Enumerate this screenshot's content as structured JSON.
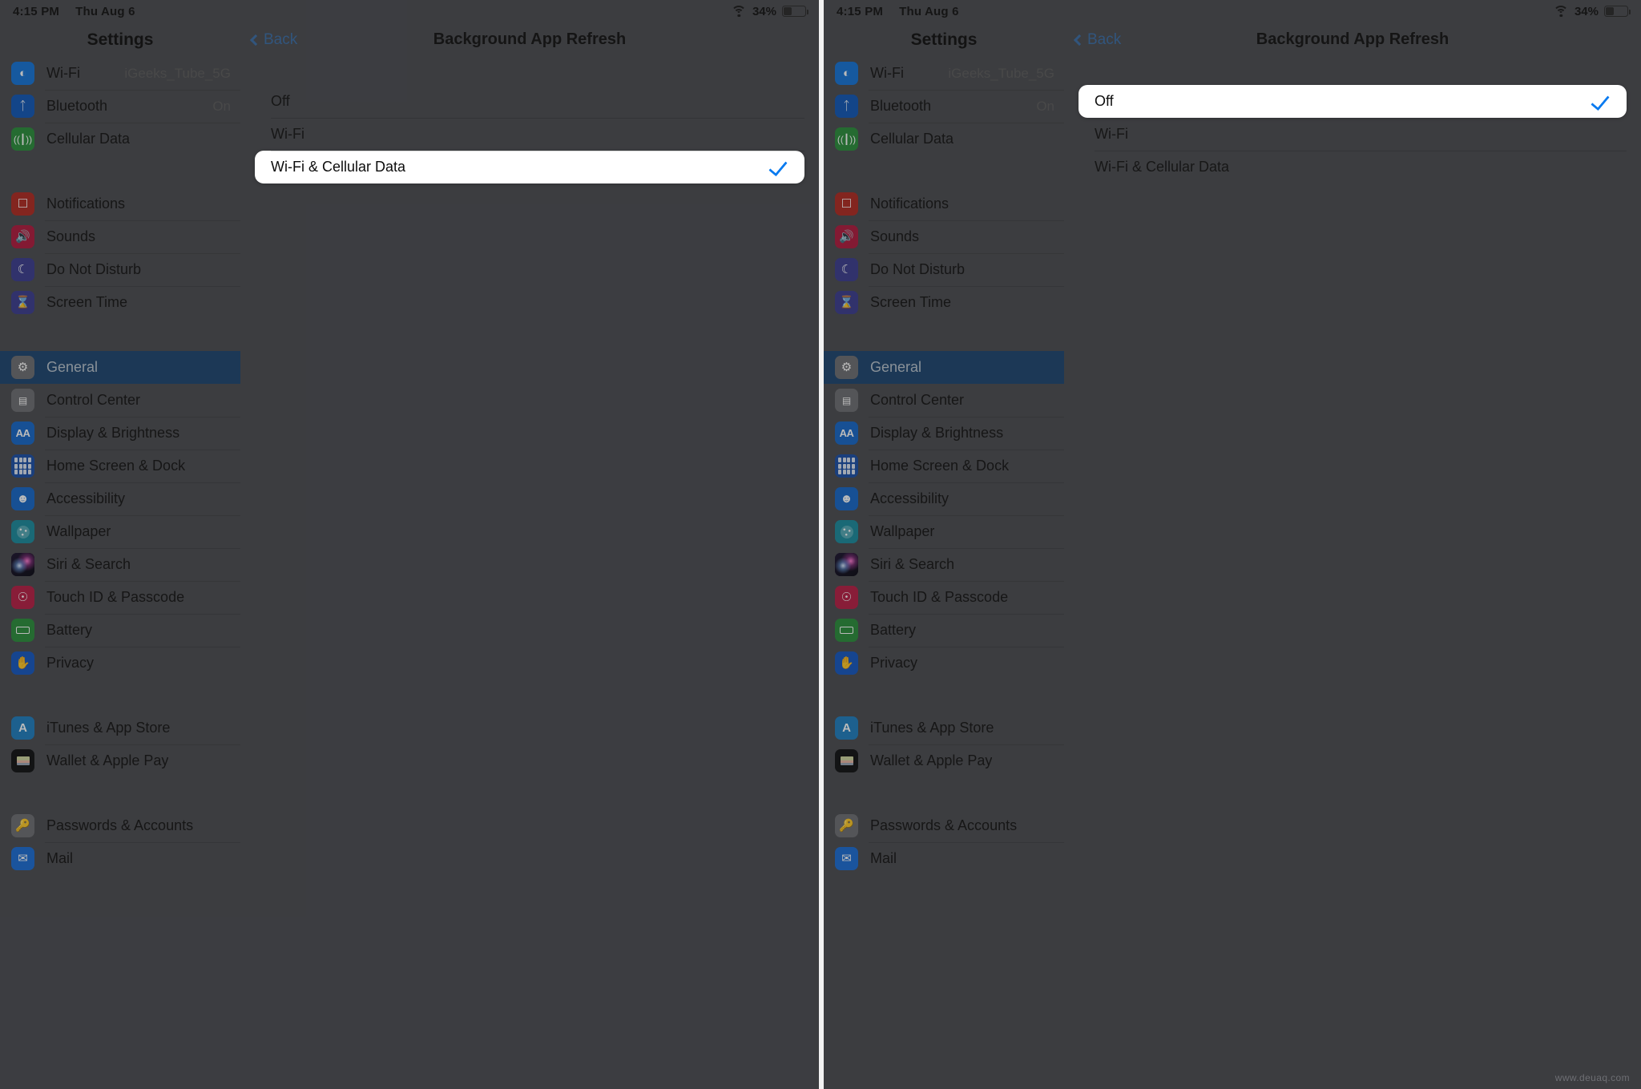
{
  "status_bar": {
    "time": "4:15 PM",
    "date": "Thu Aug 6",
    "battery_percent": "34%",
    "wifi_icon": "wifi-icon",
    "battery_icon": "battery-icon"
  },
  "sidebar": {
    "title": "Settings",
    "groups": [
      {
        "items": [
          {
            "label": "Wi-Fi",
            "value": "iGeeks_Tube_5G",
            "icon": "wifi-icon",
            "color": "#1574d8"
          },
          {
            "label": "Bluetooth",
            "value": "On",
            "icon": "bluetooth-icon",
            "color": "#1158b8"
          },
          {
            "label": "Cellular Data",
            "value": "",
            "icon": "cellular-icon",
            "color": "#2a8f3c"
          }
        ]
      },
      {
        "items": [
          {
            "label": "Notifications",
            "value": "",
            "icon": "notifications-icon",
            "color": "#b02a22"
          },
          {
            "label": "Sounds",
            "value": "",
            "icon": "sounds-icon",
            "color": "#b01a3e"
          },
          {
            "label": "Do Not Disturb",
            "value": "",
            "icon": "moon-icon",
            "color": "#3b3d90"
          },
          {
            "label": "Screen Time",
            "value": "",
            "icon": "hourglass-icon",
            "color": "#3b3d90"
          }
        ]
      },
      {
        "items": [
          {
            "label": "General",
            "value": "",
            "icon": "gear-icon",
            "color": "#6e6f73",
            "selected": true
          },
          {
            "label": "Control Center",
            "value": "",
            "icon": "control-center-icon",
            "color": "#6e6f73"
          },
          {
            "label": "Display & Brightness",
            "value": "",
            "icon": "display-brightness-icon",
            "color": "#1668c9"
          },
          {
            "label": "Home Screen & Dock",
            "value": "",
            "icon": "home-screen-dock-icon",
            "color": "#1b4fa8"
          },
          {
            "label": "Accessibility",
            "value": "",
            "icon": "accessibility-icon",
            "color": "#1668c9"
          },
          {
            "label": "Wallpaper",
            "value": "",
            "icon": "wallpaper-icon",
            "color": "#1b8c9e"
          },
          {
            "label": "Siri & Search",
            "value": "",
            "icon": "siri-icon",
            "color": "#16101f"
          },
          {
            "label": "Touch ID & Passcode",
            "value": "",
            "icon": "touch-id-icon",
            "color": "#b81f45"
          },
          {
            "label": "Battery",
            "value": "",
            "icon": "battery-icon",
            "color": "#2a8f3c"
          },
          {
            "label": "Privacy",
            "value": "",
            "icon": "privacy-hand-icon",
            "color": "#1558c2"
          }
        ]
      },
      {
        "items": [
          {
            "label": "iTunes & App Store",
            "value": "",
            "icon": "app-store-icon",
            "color": "#1f7fc0"
          },
          {
            "label": "Wallet & Apple Pay",
            "value": "",
            "icon": "wallet-icon",
            "color": "#111214"
          }
        ]
      },
      {
        "items": [
          {
            "label": "Passwords & Accounts",
            "value": "",
            "icon": "key-icon",
            "color": "#6e6f73"
          },
          {
            "label": "Mail",
            "value": "",
            "icon": "mail-icon",
            "color": "#1b6ed6"
          }
        ]
      }
    ]
  },
  "detail": {
    "back_label": "Back",
    "title": "Background App Refresh",
    "options_left": [
      {
        "label": "Off",
        "selected": false
      },
      {
        "label": "Wi-Fi",
        "selected": false
      },
      {
        "label": "Wi-Fi & Cellular Data",
        "selected": true
      }
    ],
    "options_right": [
      {
        "label": "Off",
        "selected": true
      },
      {
        "label": "Wi-Fi",
        "selected": false
      },
      {
        "label": "Wi-Fi & Cellular Data",
        "selected": false
      }
    ],
    "checkmark_icon": "checkmark-icon",
    "back_chevron_icon": "chevron-left-icon"
  },
  "watermark": "www.deuaq.com",
  "colors": {
    "accent_blue": "#0a7bf0",
    "selected_row": "#1d4570",
    "panel_bg": "#4b4c51",
    "sheet_white": "#ffffff"
  }
}
